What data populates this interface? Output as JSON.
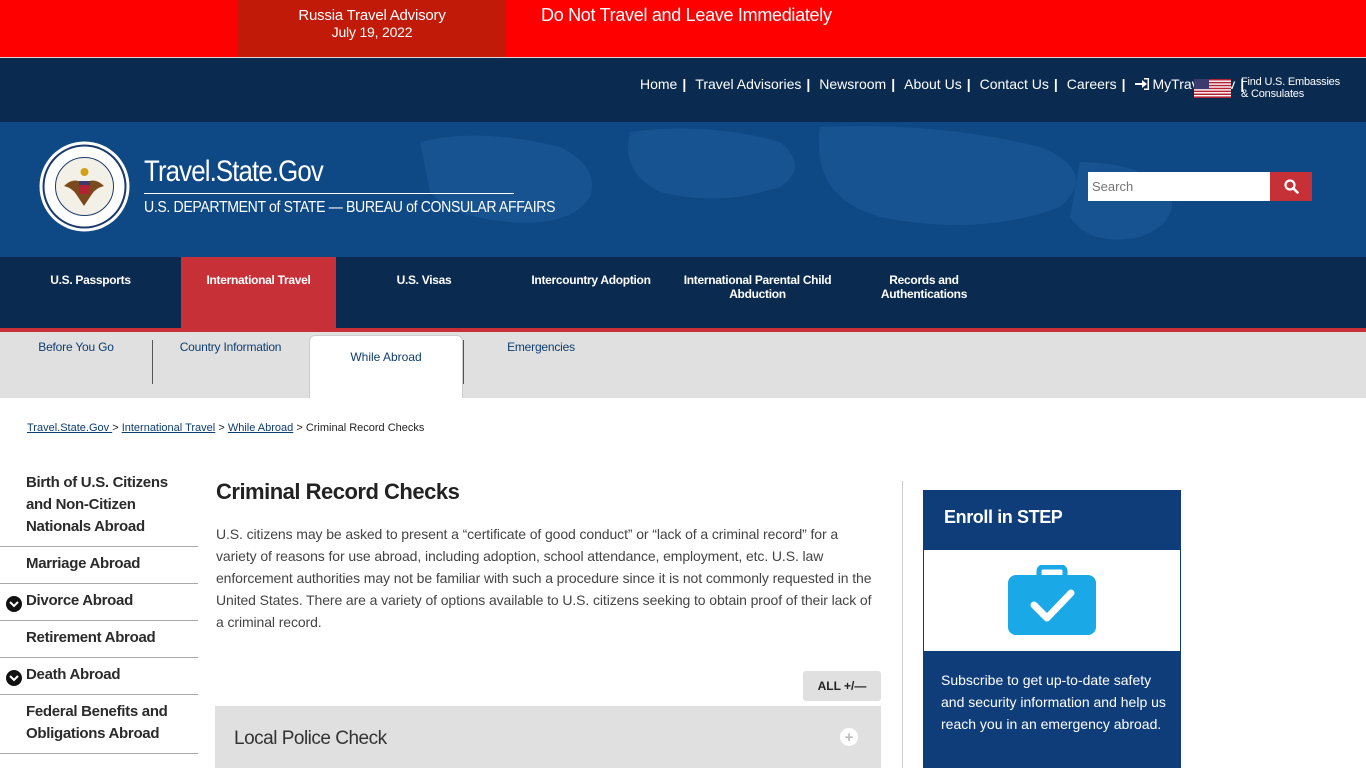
{
  "alert": {
    "title": "Russia Travel Advisory",
    "date": "July 19, 2022",
    "message": "Do Not Travel and Leave Immediately"
  },
  "util_nav": {
    "items": [
      "Home",
      "Travel Advisories",
      "Newsroom",
      "About Us",
      "Contact Us",
      "Careers"
    ],
    "my_travel": "MyTravelGov",
    "embassy_line1": "Find U.S. Embassies",
    "embassy_line2": "& Consulates"
  },
  "header": {
    "title": "Travel.State.Gov",
    "subtitle": "U.S. DEPARTMENT of STATE — BUREAU of CONSULAR AFFAIRS",
    "search_placeholder": "Search"
  },
  "main_nav": {
    "items": [
      {
        "label": "U.S. Passports"
      },
      {
        "label": "International Travel"
      },
      {
        "label": "U.S. Visas"
      },
      {
        "label": "Intercountry Adoption"
      },
      {
        "label": "International Parental Child Abduction"
      },
      {
        "label": "Records and Authentications"
      }
    ],
    "active_index": 1
  },
  "sub_nav": {
    "items": [
      "Before You Go",
      "Country Information",
      "While Abroad",
      "Emergencies"
    ],
    "active": "While Abroad"
  },
  "breadcrumb": {
    "links": [
      "Travel.State.Gov ",
      "International Travel",
      "While Abroad"
    ],
    "current": "Criminal Record Checks",
    "sep": ">"
  },
  "sidebar": {
    "items": [
      {
        "label": "Birth of U.S. Citizens and Non-Citizen Nationals Abroad",
        "expandable": false
      },
      {
        "label": "Marriage Abroad",
        "expandable": false
      },
      {
        "label": "Divorce Abroad",
        "expandable": true
      },
      {
        "label": "Retirement Abroad",
        "expandable": false
      },
      {
        "label": "Death Abroad",
        "expandable": true
      },
      {
        "label": "Federal Benefits and Obligations Abroad",
        "expandable": false
      }
    ]
  },
  "content": {
    "title": "Criminal Record Checks",
    "intro": "U.S. citizens may be asked to present a “certificate of good conduct” or “lack of a criminal record” for a variety of reasons for use abroad, including adoption, school attendance, employment, etc. U.S. law enforcement authorities may not be familiar with such a procedure since it is not commonly requested in the United States. There are a variety of options available to U.S. citizens seeking to obtain proof of their lack of a criminal record.",
    "all_button": "ALL +/—",
    "accordion_title": "Local Police Check"
  },
  "step": {
    "title": "Enroll in STEP",
    "text": "Subscribe to get up-to-date safety and security information and help us reach you in an emergency abroad."
  },
  "colors": {
    "alert_red": "#ff0000",
    "alert_dark_red": "#c21a09",
    "navy": "#0a2a4f",
    "header_blue": "#0e4885",
    "accent_red": "#c83038",
    "step_blue": "#0e3d7a",
    "step_icon": "#1aa9e6"
  }
}
